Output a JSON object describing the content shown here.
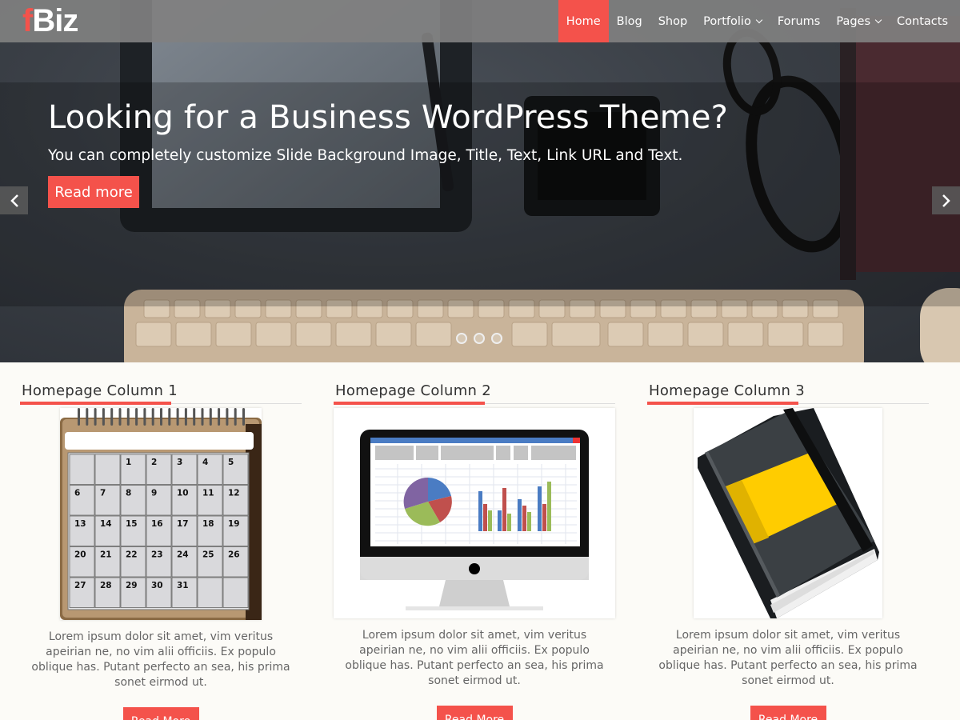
{
  "header": {
    "logo_accent": "f",
    "logo_rest": "Biz",
    "nav": [
      {
        "label": "Home",
        "active": true,
        "dropdown": false
      },
      {
        "label": "Blog",
        "active": false,
        "dropdown": false
      },
      {
        "label": "Shop",
        "active": false,
        "dropdown": false
      },
      {
        "label": "Portfolio",
        "active": false,
        "dropdown": true
      },
      {
        "label": "Forums",
        "active": false,
        "dropdown": false
      },
      {
        "label": "Pages",
        "active": false,
        "dropdown": true
      },
      {
        "label": "Contacts",
        "active": false,
        "dropdown": false
      }
    ]
  },
  "slider": {
    "title": "Looking for a Business WordPress Theme?",
    "text": "You can completely customize Slide Background Image, Title, Text, Link URL and Text.",
    "button": "Read more",
    "prev_icon": "chevron-left-icon",
    "next_icon": "chevron-right-icon",
    "dots": 3
  },
  "columns": [
    {
      "title": "Homepage Column 1",
      "image": "calendar",
      "text": "Lorem ipsum dolor sit amet, vim veritus apeirian ne, no vim alii officiis. Ex populo oblique has. Putant perfecto an sea, his prima sonet eirmod ut.",
      "button": "Read More"
    },
    {
      "title": "Homepage Column 2",
      "image": "monitor-spreadsheet",
      "text": "Lorem ipsum dolor sit amet, vim veritus apeirian ne, no vim alii officiis. Ex populo oblique has. Putant perfecto an sea, his prima sonet eirmod ut.",
      "button": "Read More"
    },
    {
      "title": "Homepage Column 3",
      "image": "notebook",
      "text": "Lorem ipsum dolor sit amet, vim veritus apeirian ne, no vim alii officiis. Ex populo oblique has. Putant perfecto an sea, his prima sonet eirmod ut.",
      "button": "Read More"
    }
  ],
  "calendar_days": [
    "1",
    "2",
    "3",
    "4",
    "5",
    "6",
    "7",
    "8",
    "9",
    "10",
    "11",
    "12",
    "13",
    "14",
    "15",
    "16",
    "17",
    "18",
    "19",
    "20",
    "21",
    "22",
    "23",
    "24",
    "25",
    "26",
    "27",
    "28",
    "29",
    "30",
    "31"
  ],
  "colors": {
    "accent": "#f4524b",
    "header": "#808080",
    "background": "#fcfbf7"
  }
}
